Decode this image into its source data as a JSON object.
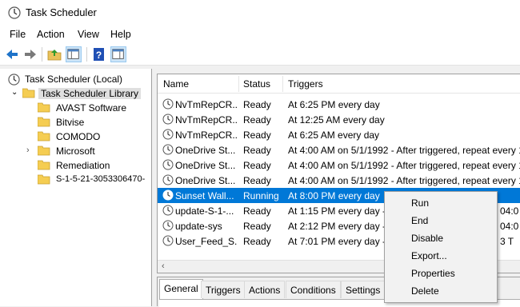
{
  "window": {
    "title": "Task Scheduler"
  },
  "menu": [
    "File",
    "Action",
    "View",
    "Help"
  ],
  "toolbar": {
    "icons": [
      "back-arrow-icon",
      "forward-arrow-icon",
      "up-folder-icon",
      "show-hide-console-tree-icon",
      "help-icon",
      "show-hide-action-pane-icon"
    ]
  },
  "tree": {
    "root": "Task Scheduler (Local)",
    "library": "Task Scheduler Library",
    "children": [
      "AVAST Software",
      "Bitvise",
      "COMODO",
      "Microsoft",
      "Remediation",
      "S-1-5-21-3053306470-"
    ]
  },
  "table": {
    "columns": [
      "Name",
      "Status",
      "Triggers"
    ],
    "rows": [
      {
        "name": "NvTmRepCR...",
        "status": "Ready",
        "trigger": "At 6:25 PM every day"
      },
      {
        "name": "NvTmRepCR...",
        "status": "Ready",
        "trigger": "At 12:25 AM every day"
      },
      {
        "name": "NvTmRepCR...",
        "status": "Ready",
        "trigger": "At 6:25 AM every day"
      },
      {
        "name": "OneDrive St...",
        "status": "Ready",
        "trigger": "At 4:00 AM on 5/1/1992 - After triggered, repeat every 1"
      },
      {
        "name": "OneDrive St...",
        "status": "Ready",
        "trigger": "At 4:00 AM on 5/1/1992 - After triggered, repeat every 1"
      },
      {
        "name": "OneDrive St...",
        "status": "Ready",
        "trigger": "At 4:00 AM on 5/1/1992 - After triggered, repeat every 1"
      },
      {
        "name": "Sunset Wall...",
        "status": "Running",
        "trigger": "At 8:00 PM every day"
      },
      {
        "name": "update-S-1-...",
        "status": "Ready",
        "trigger": "At 1:15 PM every day - Af"
      },
      {
        "name": "update-sys",
        "status": "Ready",
        "trigger": "At 2:12 PM every day - Af"
      },
      {
        "name": "User_Feed_S...",
        "status": "Ready",
        "trigger": "At 7:01 PM every day - Af"
      }
    ],
    "overflow_right": [
      "",
      "",
      "",
      "",
      "",
      "",
      "",
      "04:0",
      "04:0",
      "3 T"
    ]
  },
  "context_menu": [
    "Run",
    "End",
    "Disable",
    "Export...",
    "Properties",
    "Delete"
  ],
  "tabs": [
    "General",
    "Triggers",
    "Actions",
    "Conditions",
    "Settings"
  ],
  "colors": {
    "selection": "#0078d7",
    "folder": "#f5cd52"
  }
}
